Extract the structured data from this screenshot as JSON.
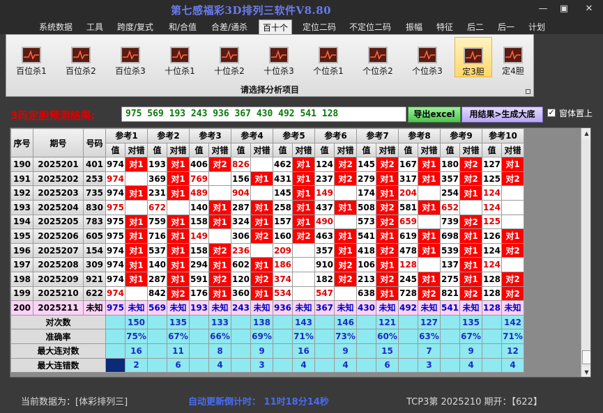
{
  "window": {
    "title": "第七感福彩3D排列三软件V8.80",
    "min": "—",
    "max": "▣",
    "close": "✕"
  },
  "menu": [
    "系统数据",
    "工具",
    "跨度/复式",
    "和/合值",
    "合差/通杀",
    "百十个",
    "定位二码",
    "不定位二码",
    "振幅",
    "特征",
    "后二",
    "后一",
    "计划"
  ],
  "menu_active": "百十个",
  "ribbon": {
    "buttons": [
      "百位杀1",
      "百位杀2",
      "百位杀3",
      "十位杀1",
      "十位杀2",
      "十位杀3",
      "个位杀1",
      "个位杀2",
      "个位杀3",
      "定3胆",
      "定4胆"
    ],
    "selected": "定3胆",
    "caption": "请选择分析项目"
  },
  "prediction": {
    "label": "3码定胆预测结果:",
    "result": "975 569 193 243 936 367 430 492 541 128",
    "export_button": "导出excel",
    "generate_button": "用结果>生成大底",
    "topmost_checked": "✓",
    "topmost_label": "窗体置上"
  },
  "table": {
    "headers": {
      "seq": "序号",
      "period": "期号",
      "number": "号码",
      "value": "值",
      "result": "对错"
    },
    "refs": [
      "参考1",
      "参考2",
      "参考3",
      "参考4",
      "参考5",
      "参考6",
      "参考7",
      "参考8",
      "参考9",
      "参考10"
    ],
    "rows": [
      {
        "seq": "190",
        "period": "2025201",
        "num": "401",
        "cells": [
          [
            "974",
            "对1"
          ],
          [
            "193",
            "对1"
          ],
          [
            "406",
            "对2"
          ],
          [
            "826",
            ""
          ],
          [
            "462",
            "对1"
          ],
          [
            "124",
            "对2"
          ],
          [
            "145",
            "对2"
          ],
          [
            "167",
            "对1"
          ],
          [
            "180",
            "对2"
          ],
          [
            "127",
            "对1"
          ]
        ]
      },
      {
        "seq": "191",
        "period": "2025202",
        "num": "253",
        "cells": [
          [
            "974",
            ""
          ],
          [
            "369",
            "对1"
          ],
          [
            "769",
            ""
          ],
          [
            "156",
            "对1"
          ],
          [
            "431",
            "对1"
          ],
          [
            "237",
            "对2"
          ],
          [
            "279",
            "对1"
          ],
          [
            "317",
            "对1"
          ],
          [
            "357",
            "对2"
          ],
          [
            "125",
            "对2"
          ]
        ]
      },
      {
        "seq": "192",
        "period": "2025203",
        "num": "735",
        "cells": [
          [
            "974",
            "对1"
          ],
          [
            "231",
            "对1"
          ],
          [
            "489",
            ""
          ],
          [
            "904",
            ""
          ],
          [
            "145",
            "对1"
          ],
          [
            "149",
            ""
          ],
          [
            "174",
            "对1"
          ],
          [
            "204",
            ""
          ],
          [
            "254",
            "对1"
          ],
          [
            "124",
            ""
          ]
        ]
      },
      {
        "seq": "193",
        "period": "2025204",
        "num": "830",
        "cells": [
          [
            "975",
            ""
          ],
          [
            "672",
            ""
          ],
          [
            "140",
            "对1"
          ],
          [
            "287",
            "对1"
          ],
          [
            "258",
            "对1"
          ],
          [
            "437",
            "对1"
          ],
          [
            "508",
            "对2"
          ],
          [
            "581",
            "对1"
          ],
          [
            "652",
            ""
          ],
          [
            "124",
            ""
          ]
        ]
      },
      {
        "seq": "194",
        "period": "2025205",
        "num": "783",
        "cells": [
          [
            "975",
            "对1"
          ],
          [
            "759",
            "对1"
          ],
          [
            "158",
            "对1"
          ],
          [
            "324",
            "对1"
          ],
          [
            "157",
            "对1"
          ],
          [
            "490",
            ""
          ],
          [
            "573",
            "对2"
          ],
          [
            "659",
            ""
          ],
          [
            "739",
            "对2"
          ],
          [
            "125",
            ""
          ]
        ]
      },
      {
        "seq": "195",
        "period": "2025206",
        "num": "605",
        "cells": [
          [
            "975",
            "对1"
          ],
          [
            "716",
            "对1"
          ],
          [
            "149",
            ""
          ],
          [
            "306",
            "对2"
          ],
          [
            "160",
            "对2"
          ],
          [
            "463",
            "对1"
          ],
          [
            "541",
            "对1"
          ],
          [
            "619",
            "对1"
          ],
          [
            "698",
            "对1"
          ],
          [
            "126",
            "对1"
          ]
        ]
      },
      {
        "seq": "196",
        "period": "2025207",
        "num": "154",
        "cells": [
          [
            "974",
            "对1"
          ],
          [
            "537",
            "对1"
          ],
          [
            "158",
            "对2"
          ],
          [
            "236",
            ""
          ],
          [
            "209",
            ""
          ],
          [
            "357",
            "对1"
          ],
          [
            "418",
            "对2"
          ],
          [
            "478",
            "对1"
          ],
          [
            "539",
            "对1"
          ],
          [
            "124",
            "对2"
          ]
        ]
      },
      {
        "seq": "197",
        "period": "2025208",
        "num": "309",
        "cells": [
          [
            "974",
            "对1"
          ],
          [
            "140",
            "对1"
          ],
          [
            "294",
            "对1"
          ],
          [
            "602",
            "对1"
          ],
          [
            "186",
            ""
          ],
          [
            "910",
            "对2"
          ],
          [
            "106",
            "对1"
          ],
          [
            "128",
            ""
          ],
          [
            "137",
            "对1"
          ],
          [
            "124",
            ""
          ]
        ]
      },
      {
        "seq": "198",
        "period": "2025209",
        "num": "921",
        "cells": [
          [
            "974",
            "对1"
          ],
          [
            "287",
            "对1"
          ],
          [
            "591",
            "对2"
          ],
          [
            "120",
            "对2"
          ],
          [
            "374",
            ""
          ],
          [
            "182",
            "对2"
          ],
          [
            "213",
            "对2"
          ],
          [
            "245",
            "对1"
          ],
          [
            "275",
            "对1"
          ],
          [
            "128",
            "对2"
          ]
        ]
      },
      {
        "seq": "199",
        "period": "2025210",
        "num": "622",
        "cells": [
          [
            "974",
            ""
          ],
          [
            "842",
            "对2"
          ],
          [
            "176",
            "对1"
          ],
          [
            "360",
            "对1"
          ],
          [
            "534",
            ""
          ],
          [
            "547",
            ""
          ],
          [
            "638",
            "对1"
          ],
          [
            "728",
            "对2"
          ],
          [
            "821",
            "对2"
          ],
          [
            "128",
            "对2"
          ]
        ]
      }
    ],
    "prediction_row": {
      "seq": "200",
      "period": "2025211",
      "num": "未知",
      "cells": [
        [
          "975",
          "未知"
        ],
        [
          "569",
          "未知"
        ],
        [
          "193",
          "未知"
        ],
        [
          "243",
          "未知"
        ],
        [
          "936",
          "未知"
        ],
        [
          "367",
          "未知"
        ],
        [
          "430",
          "未知"
        ],
        [
          "492",
          "未知"
        ],
        [
          "541",
          "未知"
        ],
        [
          "128",
          "未知"
        ]
      ]
    },
    "stats": [
      {
        "label": "对次数",
        "values": [
          "150",
          "135",
          "133",
          "138",
          "143",
          "146",
          "121",
          "127",
          "135",
          "142"
        ]
      },
      {
        "label": "准确率",
        "values": [
          "75%",
          "67%",
          "66%",
          "69%",
          "71%",
          "73%",
          "60%",
          "63%",
          "67%",
          "71%"
        ]
      },
      {
        "label": "最大连对数",
        "values": [
          "16",
          "11",
          "8",
          "9",
          "16",
          "9",
          "15",
          "7",
          "9",
          "12"
        ]
      },
      {
        "label": "最大连错数",
        "values": [
          "2",
          "6",
          "4",
          "3",
          "4",
          "4",
          "6",
          "3",
          "4",
          "4"
        ]
      }
    ]
  },
  "scroll": {
    "up": "▲",
    "down": "▼"
  },
  "status": {
    "data_source": "当前数据为：[体彩排列三]",
    "countdown": "自动更新倒计时：  11时18分14秒",
    "draw_info": "TCP3第  2025210 期开：【622】"
  }
}
